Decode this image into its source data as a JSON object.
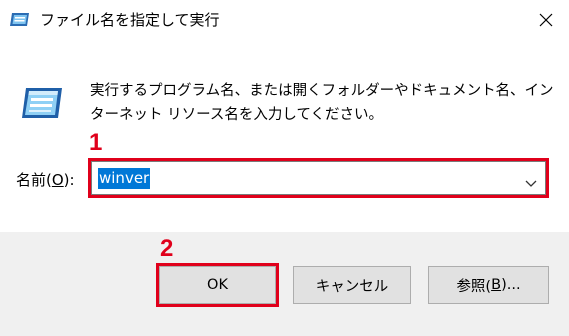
{
  "window": {
    "title": "ファイル名を指定して実行",
    "close_glyph": "✕"
  },
  "description": "実行するプログラム名、または開くフォルダーやドキュメント名、インターネット リソース名を入力してください。",
  "annotations": {
    "step1": "1",
    "step2": "2"
  },
  "open_field": {
    "label_prefix": "名前(",
    "label_accel": "O",
    "label_suffix": "):",
    "value": "winver"
  },
  "buttons": {
    "ok": "OK",
    "cancel": "キャンセル",
    "browse_prefix": "参照(",
    "browse_accel": "B",
    "browse_suffix": ")..."
  },
  "colors": {
    "highlight": "#e0001b",
    "selection": "#0078d7"
  }
}
